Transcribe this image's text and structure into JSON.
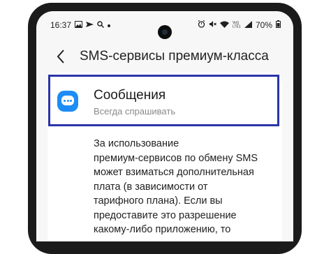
{
  "status_bar": {
    "time": "16:37",
    "battery": "70%",
    "left_icons": [
      "image-icon",
      "send-icon",
      "search-icon",
      "dot-icon"
    ],
    "right_icons": [
      "alarm-icon",
      "mute-icon",
      "wifi-icon",
      "volte-icon",
      "signal-icon",
      "battery-icon"
    ],
    "volte_label": "Vo))\nLTE1"
  },
  "app_bar": {
    "back_icon": "chevron-left-icon",
    "title": "SMS-сервисы премиум-класса"
  },
  "app_item": {
    "icon": "messages-app-icon",
    "icon_color": "#1d8cf5",
    "name": "Сообщения",
    "subtitle": "Всегда спрашивать"
  },
  "highlight_color": "#2b34a8",
  "description": {
    "lines": [
      "За использование",
      "премиум-сервисов по обмену SMS",
      "может взиматься дополнительная",
      "плата (в зависимости от",
      "тарифного плана). Если вы",
      "предоставите это разрешение",
      "какому-либо приложению, то"
    ]
  }
}
